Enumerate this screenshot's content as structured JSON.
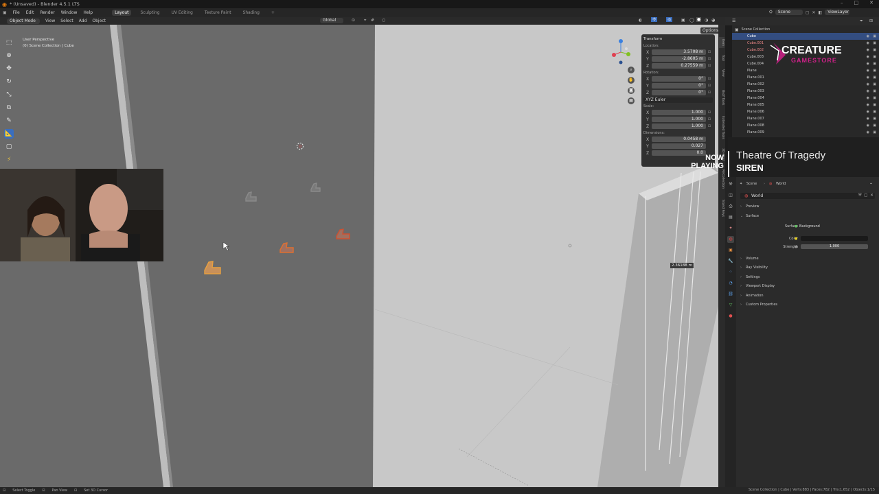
{
  "app": {
    "title": "* (Unsaved) - Blender 4.5.1 LTS"
  },
  "menu": {
    "items": [
      "File",
      "Edit",
      "Render",
      "Window",
      "Help"
    ],
    "workspaces": [
      "Layout",
      "Sculpting",
      "UV Editing",
      "Texture Paint",
      "Shading",
      "+"
    ]
  },
  "scene_field": "Scene",
  "viewlayer_field": "ViewLayer",
  "viewport_header": {
    "mode": "Object Mode",
    "menus": [
      "View",
      "Select",
      "Add",
      "Object"
    ],
    "orientation": "Global",
    "options": "Options"
  },
  "viewport_info": {
    "perspective": "User Perspective",
    "collection": "(0) Scene Collection | Cube"
  },
  "right_tabs": [
    "Item",
    "Tool",
    "View",
    "Bsdf Tools",
    "Extended Tools",
    "3D-Print",
    "ReCollection",
    "Stand Keys"
  ],
  "npanel": {
    "header": "Transform",
    "location_label": "Location:",
    "location": [
      {
        "axis": "X",
        "value": "3.5708 m"
      },
      {
        "axis": "Y",
        "value": "-2.8605 m"
      },
      {
        "axis": "Z",
        "value": "0.27559 m"
      }
    ],
    "rotation_label": "Rotation:",
    "rotation": [
      {
        "axis": "X",
        "value": "0°"
      },
      {
        "axis": "Y",
        "value": "0°"
      },
      {
        "axis": "Z",
        "value": "0°"
      }
    ],
    "rotation_mode": "XYZ Euler",
    "scale_label": "Scale:",
    "scale": [
      {
        "axis": "X",
        "value": "1.000"
      },
      {
        "axis": "Y",
        "value": "1.000"
      },
      {
        "axis": "Z",
        "value": "1.000"
      }
    ],
    "dimensions_label": "Dimensions:",
    "dimensions": [
      {
        "axis": "X",
        "value": "0.0458 m"
      },
      {
        "axis": "Y",
        "value": "0.027"
      },
      {
        "axis": "Z",
        "value": "0.0"
      }
    ]
  },
  "measure": "2.36188 m",
  "outliner": {
    "root": "Scene Collection",
    "items": [
      "Cube",
      "Cube.001",
      "Cube.002",
      "Cube.003",
      "Cube.004",
      "Plane",
      "Plane.001",
      "Plane.002",
      "Plane.003",
      "Plane.004",
      "Plane.005",
      "Plane.006",
      "Plane.007",
      "Plane.008",
      "Plane.009"
    ]
  },
  "overlay": {
    "now_playing": "NOW PLAYING",
    "song": "Theatre Of Tragedy",
    "artist": "SIREN",
    "brand_top": "CREATURE",
    "brand_bottom": "GAMESTORE"
  },
  "properties": {
    "breadcrumb_scene": "Scene",
    "breadcrumb_world": "World",
    "world_name": "World",
    "panels": [
      "Preview",
      "Surface"
    ],
    "surface_label": "Surface",
    "surface_value": "Background",
    "color_label": "Color",
    "strength_label": "Strength",
    "strength_value": "1.000",
    "collapsed": [
      "Volume",
      "Ray Visibility",
      "Settings",
      "Viewport Display",
      "Animation",
      "Custom Properties"
    ]
  },
  "status": {
    "hints": [
      "Select Toggle",
      "Pan View",
      "Set 3D Cursor"
    ],
    "stats": "Scene Collection | Cube | Verts:883 | Faces:782 | Tris:1,652 | Objects:1/15"
  },
  "colors": {
    "accent": "#3a6ebf",
    "selection": "#e8a040",
    "active_outliner": "#334d80",
    "brand_magenta": "#d0208a"
  }
}
